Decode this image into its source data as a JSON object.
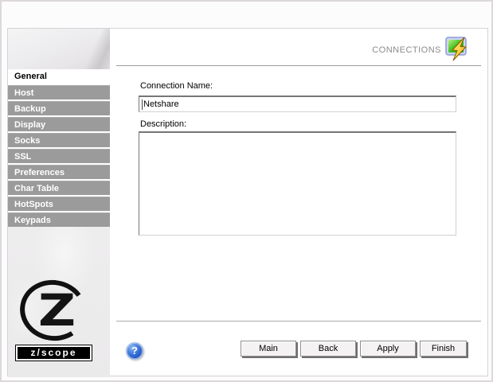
{
  "header": {
    "section_label": "CONNECTIONS",
    "icon": "monitor-lightning-icon"
  },
  "sidebar": {
    "items": [
      {
        "label": "General",
        "selected": true
      },
      {
        "label": "Host",
        "selected": false
      },
      {
        "label": "Backup",
        "selected": false
      },
      {
        "label": "Display",
        "selected": false
      },
      {
        "label": "Socks",
        "selected": false
      },
      {
        "label": "SSL",
        "selected": false
      },
      {
        "label": "Preferences",
        "selected": false
      },
      {
        "label": "Char Table",
        "selected": false
      },
      {
        "label": "HotSpots",
        "selected": false
      },
      {
        "label": "Keypads",
        "selected": false
      }
    ],
    "logo": {
      "letter": "Z",
      "wordmark": "z/scope"
    }
  },
  "form": {
    "connection_name": {
      "label": "Connection Name:",
      "value": "Netshare"
    },
    "description": {
      "label": "Description:",
      "value": ""
    }
  },
  "footer": {
    "help_symbol": "?",
    "buttons": [
      "Main",
      "Back",
      "Apply",
      "Finish"
    ]
  },
  "colors": {
    "sidebar_item_gray": "#9b9b9b",
    "header_text_gray": "#8b8b8b",
    "help_blue": "#2f6fd8",
    "icon_screen_green": "#3dbb1f",
    "icon_bolt_yellow": "#ffd34d"
  }
}
